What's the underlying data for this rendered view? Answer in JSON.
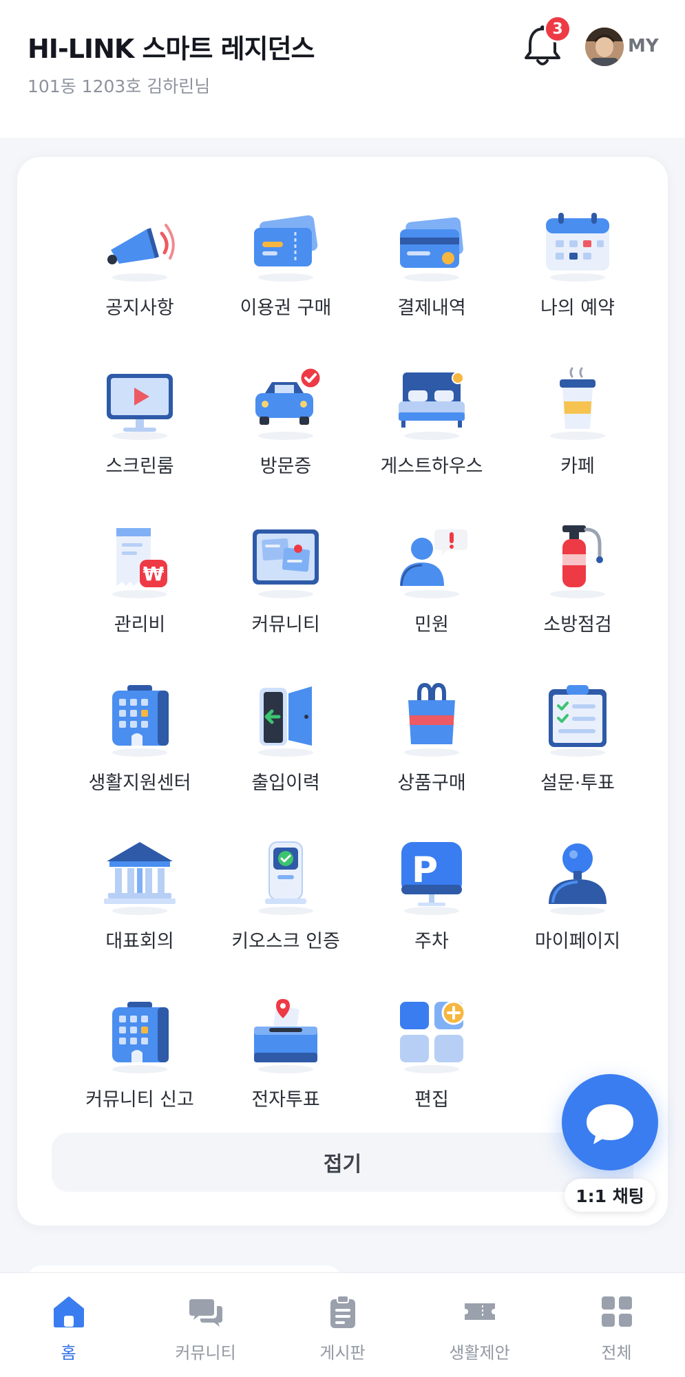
{
  "header": {
    "title": "HI-LINK 스마트 레지던스",
    "subtitle": "101동 1203호 김하린님",
    "notification_count": "3",
    "profile_label": "MY"
  },
  "menu": {
    "items": [
      {
        "label": "공지사항",
        "icon": "megaphone-icon"
      },
      {
        "label": "이용권 구매",
        "icon": "ticket-icon"
      },
      {
        "label": "결제내역",
        "icon": "credit-card-icon"
      },
      {
        "label": "나의 예약",
        "icon": "calendar-icon"
      },
      {
        "label": "스크린룸",
        "icon": "monitor-play-icon"
      },
      {
        "label": "방문증",
        "icon": "car-check-icon"
      },
      {
        "label": "게스트하우스",
        "icon": "bed-icon"
      },
      {
        "label": "카페",
        "icon": "coffee-cup-icon"
      },
      {
        "label": "관리비",
        "icon": "receipt-won-icon"
      },
      {
        "label": "커뮤니티",
        "icon": "bulletin-board-icon"
      },
      {
        "label": "민원",
        "icon": "person-alert-icon"
      },
      {
        "label": "소방점검",
        "icon": "fire-extinguisher-icon"
      },
      {
        "label": "생활지원센터",
        "icon": "building-icon"
      },
      {
        "label": "출입이력",
        "icon": "door-exit-icon"
      },
      {
        "label": "상품구매",
        "icon": "shopping-bag-icon"
      },
      {
        "label": "설문·투표",
        "icon": "clipboard-check-icon"
      },
      {
        "label": "대표회의",
        "icon": "government-building-icon"
      },
      {
        "label": "키오스크 인증",
        "icon": "kiosk-check-icon"
      },
      {
        "label": "주차",
        "icon": "parking-sign-icon"
      },
      {
        "label": "마이페이지",
        "icon": "user-icon"
      },
      {
        "label": "커뮤니티 신고",
        "icon": "building-report-icon"
      },
      {
        "label": "전자투표",
        "icon": "ballot-box-icon"
      },
      {
        "label": "편집",
        "icon": "grid-add-icon"
      }
    ],
    "collapse_label": "접기"
  },
  "chat": {
    "label": "1:1 채팅"
  },
  "tabbar": {
    "items": [
      {
        "label": "홈",
        "icon": "home-icon",
        "active": true
      },
      {
        "label": "커뮤니티",
        "icon": "chat-bubbles-icon",
        "active": false
      },
      {
        "label": "게시판",
        "icon": "clipboard-icon",
        "active": false
      },
      {
        "label": "생활제안",
        "icon": "ticket-icon",
        "active": false
      },
      {
        "label": "전체",
        "icon": "grid-icon",
        "active": false
      }
    ]
  },
  "colors": {
    "accent": "#3a7df0",
    "badge": "#ee3a45",
    "icon_blue": "#4a8ef0",
    "icon_dark": "#2e5aa8"
  }
}
